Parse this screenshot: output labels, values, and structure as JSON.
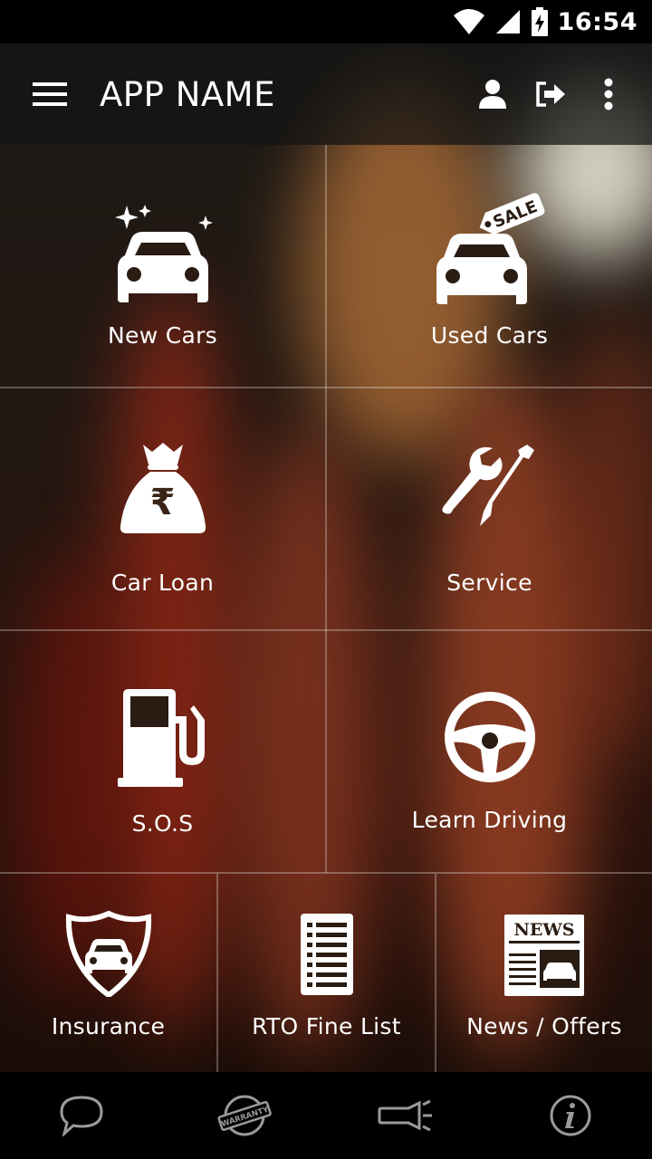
{
  "status_bar": {
    "time": "16:54"
  },
  "app_bar": {
    "title": "APP NAME"
  },
  "tiles": [
    {
      "label": "New Cars"
    },
    {
      "label": "Used Cars",
      "tag": "SALE"
    },
    {
      "label": "Car Loan",
      "currency_symbol": "₹"
    },
    {
      "label": "Service"
    },
    {
      "label": "S.O.S"
    },
    {
      "label": "Learn Driving"
    },
    {
      "label": "Insurance"
    },
    {
      "label": "RTO Fine List"
    },
    {
      "label": "News / Offers",
      "news_tag": "NEWS"
    }
  ],
  "bottom_bar": {
    "warranty_text": "WARRANTY"
  },
  "colors": {
    "app_bar_bg": "#141414",
    "icon": "#ffffff",
    "bottom_icon": "#9a9a9a"
  }
}
